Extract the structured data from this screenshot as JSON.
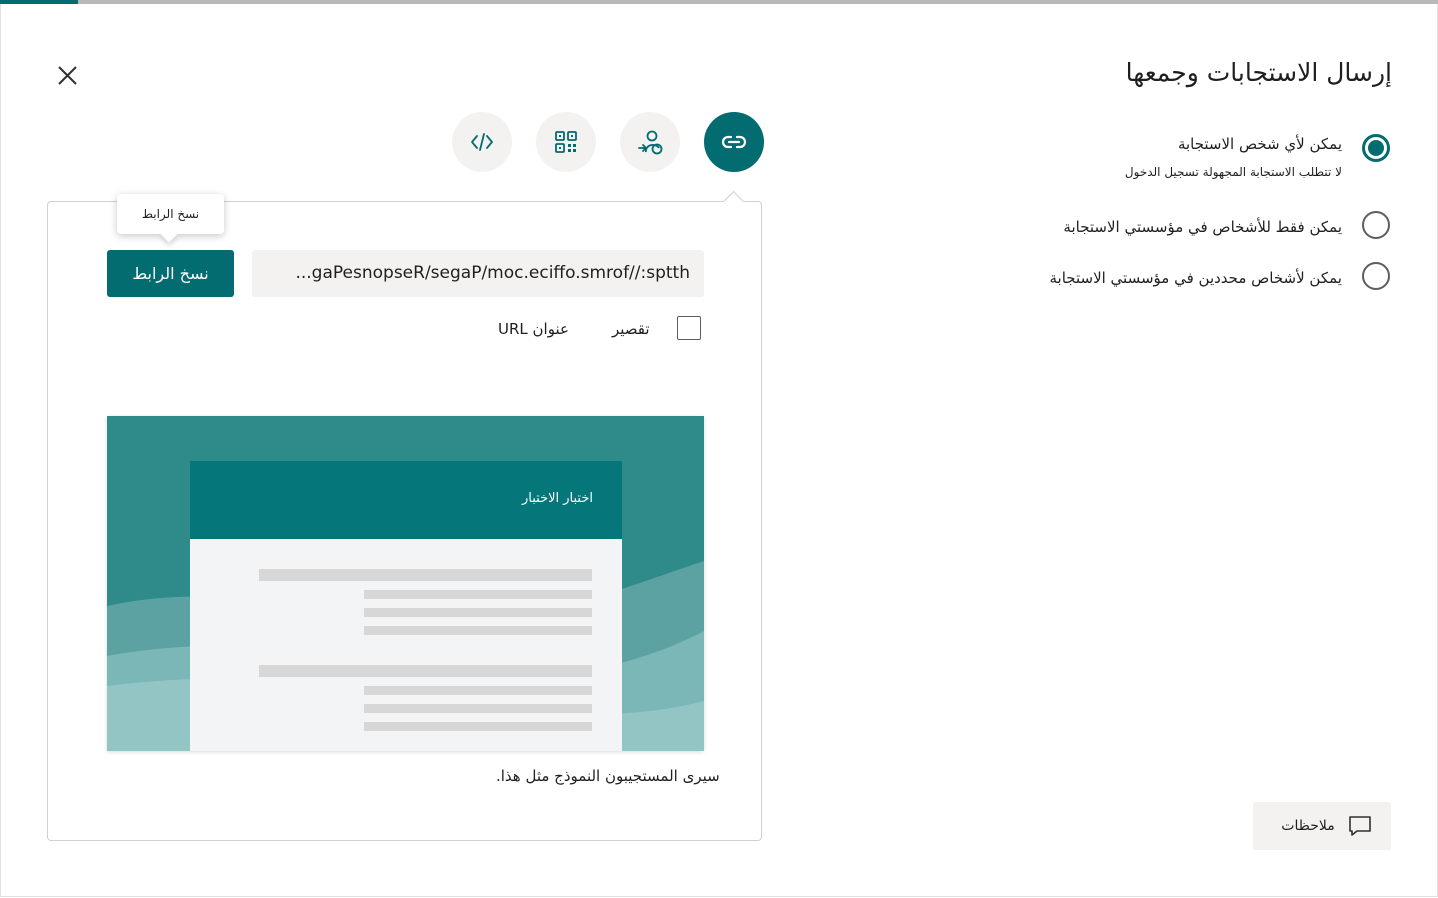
{
  "dialog": {
    "title": "إرسال الاستجابات وجمعها",
    "close_icon": "close-icon"
  },
  "access_options": [
    {
      "label": "يمكن لأي شخص الاستجابة",
      "sublabel": "لا تتطلب الاستجابة المجهولة تسجيل الدخول",
      "selected": true
    },
    {
      "label": "يمكن فقط للأشخاص في مؤسستي الاستجابة",
      "selected": false
    },
    {
      "label": "يمكن لأشخاص محددين في مؤسستي الاستجابة",
      "selected": false
    }
  ],
  "share_methods": [
    {
      "icon": "link-icon",
      "active": true
    },
    {
      "icon": "share-person-icon",
      "active": false
    },
    {
      "icon": "qr-code-icon",
      "active": false
    },
    {
      "icon": "embed-code-icon",
      "active": false
    }
  ],
  "link_panel": {
    "url": "https://forms.office.com/Pages/ResponsePag...",
    "copy_button_label": "نسخ الرابط",
    "tooltip": "نسخ الرابط",
    "shorten_label": "تقصير",
    "url_label": "عنوان URL",
    "shorten_checked": false
  },
  "preview": {
    "form_title": "اختبار الاختبار",
    "caption": "سيرى المستجيبون النموذج مثل هذا."
  },
  "feedback": {
    "label": "ملاحظات",
    "icon": "comment-icon"
  },
  "colors": {
    "accent": "#036c70",
    "preview_bg": "#2f8a8a"
  }
}
